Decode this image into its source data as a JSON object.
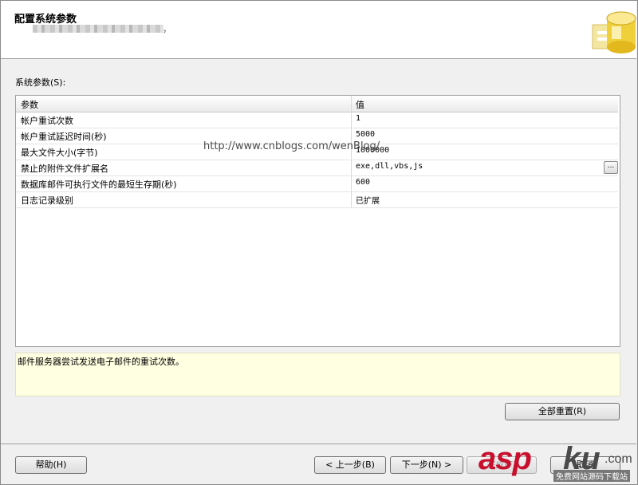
{
  "header": {
    "title": "配置系统参数",
    "subtitle_trail": "，"
  },
  "section_label": "系统参数(S):",
  "grid": {
    "columns": [
      "参数",
      "值"
    ],
    "rows": [
      {
        "name": "帐户重试次数",
        "value": "1"
      },
      {
        "name": "帐户重试延迟时间(秒)",
        "value": "5000"
      },
      {
        "name": "最大文件大小(字节)",
        "value": "1000000"
      },
      {
        "name": "禁止的附件文件扩展名",
        "value": "exe,dll,vbs,js"
      },
      {
        "name": "数据库邮件可执行文件的最短生存期(秒)",
        "value": "600"
      },
      {
        "name": "日志记录级别",
        "value": "已扩展"
      }
    ],
    "browse_label": "..."
  },
  "watermark_url": "http://www.cnblogs.com/wenBlog/",
  "description": "邮件服务器尝试发送电子邮件的重试次数。",
  "buttons": {
    "reset_all": "全部重置(R)",
    "help": "帮助(H)",
    "back": "< 上一步(B)",
    "next": "下一步(N) >",
    "finish": "完成(F)",
    "cancel": "取消"
  },
  "logo": {
    "asp": "asp",
    "ku": "ku",
    "com": ".com",
    "tag": "免费网站源码下载站"
  },
  "colors": {
    "description_bg": "#ffffe1",
    "logo_red": "#c8102e"
  }
}
